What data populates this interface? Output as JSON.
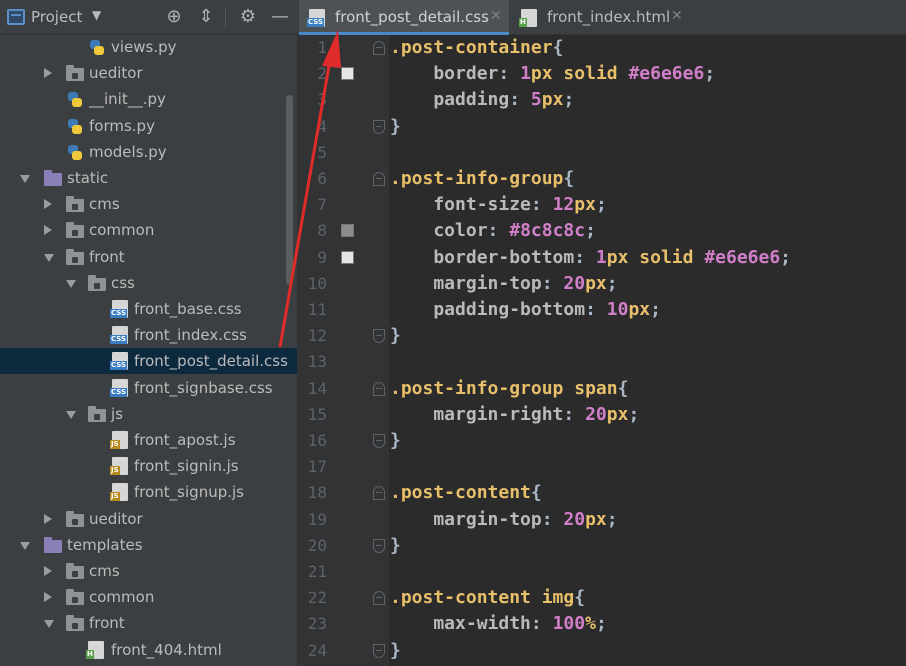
{
  "panel": {
    "title": "Project",
    "dropdown": "▼",
    "buttons": {
      "locate": "⊕",
      "collapse": "⇕",
      "settings": "⚙",
      "hide": "—"
    }
  },
  "tree": [
    {
      "label": "views.py",
      "type": "py",
      "indent": 2,
      "arrow": "none"
    },
    {
      "label": "ueditor",
      "type": "folder",
      "indent": 1,
      "arrow": "right"
    },
    {
      "label": "__init__.py",
      "type": "py",
      "indent": 1,
      "arrow": "none"
    },
    {
      "label": "forms.py",
      "type": "py",
      "indent": 1,
      "arrow": "none"
    },
    {
      "label": "models.py",
      "type": "py",
      "indent": 1,
      "arrow": "none"
    },
    {
      "label": "static",
      "type": "folder-purple",
      "indent": 0,
      "arrow": "down"
    },
    {
      "label": "cms",
      "type": "folder",
      "indent": 1,
      "arrow": "right"
    },
    {
      "label": "common",
      "type": "folder",
      "indent": 1,
      "arrow": "right"
    },
    {
      "label": "front",
      "type": "folder",
      "indent": 1,
      "arrow": "down"
    },
    {
      "label": "css",
      "type": "folder",
      "indent": 2,
      "arrow": "down"
    },
    {
      "label": "front_base.css",
      "type": "css",
      "indent": 3,
      "arrow": "none"
    },
    {
      "label": "front_index.css",
      "type": "css",
      "indent": 3,
      "arrow": "none"
    },
    {
      "label": "front_post_detail.css",
      "type": "css",
      "indent": 3,
      "arrow": "none",
      "selected": true
    },
    {
      "label": "front_signbase.css",
      "type": "css",
      "indent": 3,
      "arrow": "none"
    },
    {
      "label": "js",
      "type": "folder",
      "indent": 2,
      "arrow": "down"
    },
    {
      "label": "front_apost.js",
      "type": "js",
      "indent": 3,
      "arrow": "none"
    },
    {
      "label": "front_signin.js",
      "type": "js",
      "indent": 3,
      "arrow": "none"
    },
    {
      "label": "front_signup.js",
      "type": "js",
      "indent": 3,
      "arrow": "none"
    },
    {
      "label": "ueditor",
      "type": "folder",
      "indent": 1,
      "arrow": "right"
    },
    {
      "label": "templates",
      "type": "folder-purple",
      "indent": 0,
      "arrow": "down"
    },
    {
      "label": "cms",
      "type": "folder",
      "indent": 1,
      "arrow": "right"
    },
    {
      "label": "common",
      "type": "folder",
      "indent": 1,
      "arrow": "right"
    },
    {
      "label": "front",
      "type": "folder",
      "indent": 1,
      "arrow": "down"
    },
    {
      "label": "front_404.html",
      "type": "html",
      "indent": 2,
      "arrow": "none"
    }
  ],
  "badges": {
    "css": "CSS",
    "js": "JS",
    "html": "H"
  },
  "tabs": [
    {
      "label": "front_post_detail.css",
      "type": "css",
      "active": true,
      "close": "✕"
    },
    {
      "label": "front_index.html",
      "type": "html",
      "active": false,
      "close": "✕"
    }
  ],
  "line_numbers": [
    "1",
    "2",
    "3",
    "4",
    "5",
    "6",
    "7",
    "8",
    "9",
    "10",
    "11",
    "12",
    "13",
    "14",
    "15",
    "16",
    "17",
    "18",
    "19",
    "20",
    "21",
    "22",
    "23",
    "24"
  ],
  "swatches": [
    {
      "line": 2,
      "color": "#e6e6e6"
    },
    {
      "line": 8,
      "color": "#8c8c8c"
    },
    {
      "line": 9,
      "color": "#e6e6e6"
    }
  ],
  "folds": [
    {
      "line": 1,
      "kind": "start"
    },
    {
      "line": 4,
      "kind": "end"
    },
    {
      "line": 6,
      "kind": "start"
    },
    {
      "line": 12,
      "kind": "end"
    },
    {
      "line": 14,
      "kind": "start"
    },
    {
      "line": 16,
      "kind": "end"
    },
    {
      "line": 18,
      "kind": "start"
    },
    {
      "line": 20,
      "kind": "end"
    },
    {
      "line": 22,
      "kind": "start"
    },
    {
      "line": 24,
      "kind": "end"
    }
  ],
  "code": [
    [
      [
        "sel",
        ".post-container"
      ],
      [
        "punc",
        "{"
      ]
    ],
    [
      [
        "prop",
        "    border"
      ],
      [
        "punc",
        ": "
      ],
      [
        "num",
        "1"
      ],
      [
        "unit",
        "px"
      ],
      [
        "kw",
        " solid "
      ],
      [
        "num",
        "#e6e6e6"
      ],
      [
        "punc",
        ";"
      ]
    ],
    [
      [
        "prop",
        "    padding"
      ],
      [
        "punc",
        ": "
      ],
      [
        "num",
        "5"
      ],
      [
        "unit",
        "px"
      ],
      [
        "punc",
        ";"
      ]
    ],
    [
      [
        "punc",
        "}"
      ]
    ],
    [],
    [
      [
        "sel",
        ".post-info-group"
      ],
      [
        "punc",
        "{"
      ]
    ],
    [
      [
        "prop",
        "    font-size"
      ],
      [
        "punc",
        ": "
      ],
      [
        "num",
        "12"
      ],
      [
        "unit",
        "px"
      ],
      [
        "punc",
        ";"
      ]
    ],
    [
      [
        "prop",
        "    color"
      ],
      [
        "punc",
        ": "
      ],
      [
        "num",
        "#8c8c8c"
      ],
      [
        "punc",
        ";"
      ]
    ],
    [
      [
        "prop",
        "    border-bottom"
      ],
      [
        "punc",
        ": "
      ],
      [
        "num",
        "1"
      ],
      [
        "unit",
        "px"
      ],
      [
        "kw",
        " solid "
      ],
      [
        "num",
        "#e6e6e6"
      ],
      [
        "punc",
        ";"
      ]
    ],
    [
      [
        "prop",
        "    margin-top"
      ],
      [
        "punc",
        ": "
      ],
      [
        "num",
        "20"
      ],
      [
        "unit",
        "px"
      ],
      [
        "punc",
        ";"
      ]
    ],
    [
      [
        "prop",
        "    padding-bottom"
      ],
      [
        "punc",
        ": "
      ],
      [
        "num",
        "10"
      ],
      [
        "unit",
        "px"
      ],
      [
        "punc",
        ";"
      ]
    ],
    [
      [
        "punc",
        "}"
      ]
    ],
    [],
    [
      [
        "sel",
        ".post-info-group span"
      ],
      [
        "punc",
        "{"
      ]
    ],
    [
      [
        "prop",
        "    margin-right"
      ],
      [
        "punc",
        ": "
      ],
      [
        "num",
        "20"
      ],
      [
        "unit",
        "px"
      ],
      [
        "punc",
        ";"
      ]
    ],
    [
      [
        "punc",
        "}"
      ]
    ],
    [],
    [
      [
        "sel",
        ".post-content"
      ],
      [
        "punc",
        "{"
      ]
    ],
    [
      [
        "prop",
        "    margin-top"
      ],
      [
        "punc",
        ": "
      ],
      [
        "num",
        "20"
      ],
      [
        "unit",
        "px"
      ],
      [
        "punc",
        ";"
      ]
    ],
    [
      [
        "punc",
        "}"
      ]
    ],
    [],
    [
      [
        "sel",
        ".post-content img"
      ],
      [
        "punc",
        "{"
      ]
    ],
    [
      [
        "prop",
        "    max-width"
      ],
      [
        "punc",
        ": "
      ],
      [
        "num",
        "100"
      ],
      [
        "unit",
        "%"
      ],
      [
        "punc",
        ";"
      ]
    ],
    [
      [
        "punc",
        "}"
      ]
    ]
  ],
  "colors": {
    "selector": "#e8bf6a",
    "property": "#bababa",
    "keyword": "#cc7832",
    "number": "#6897bb",
    "annotation_arrow": "#e02b2b"
  }
}
